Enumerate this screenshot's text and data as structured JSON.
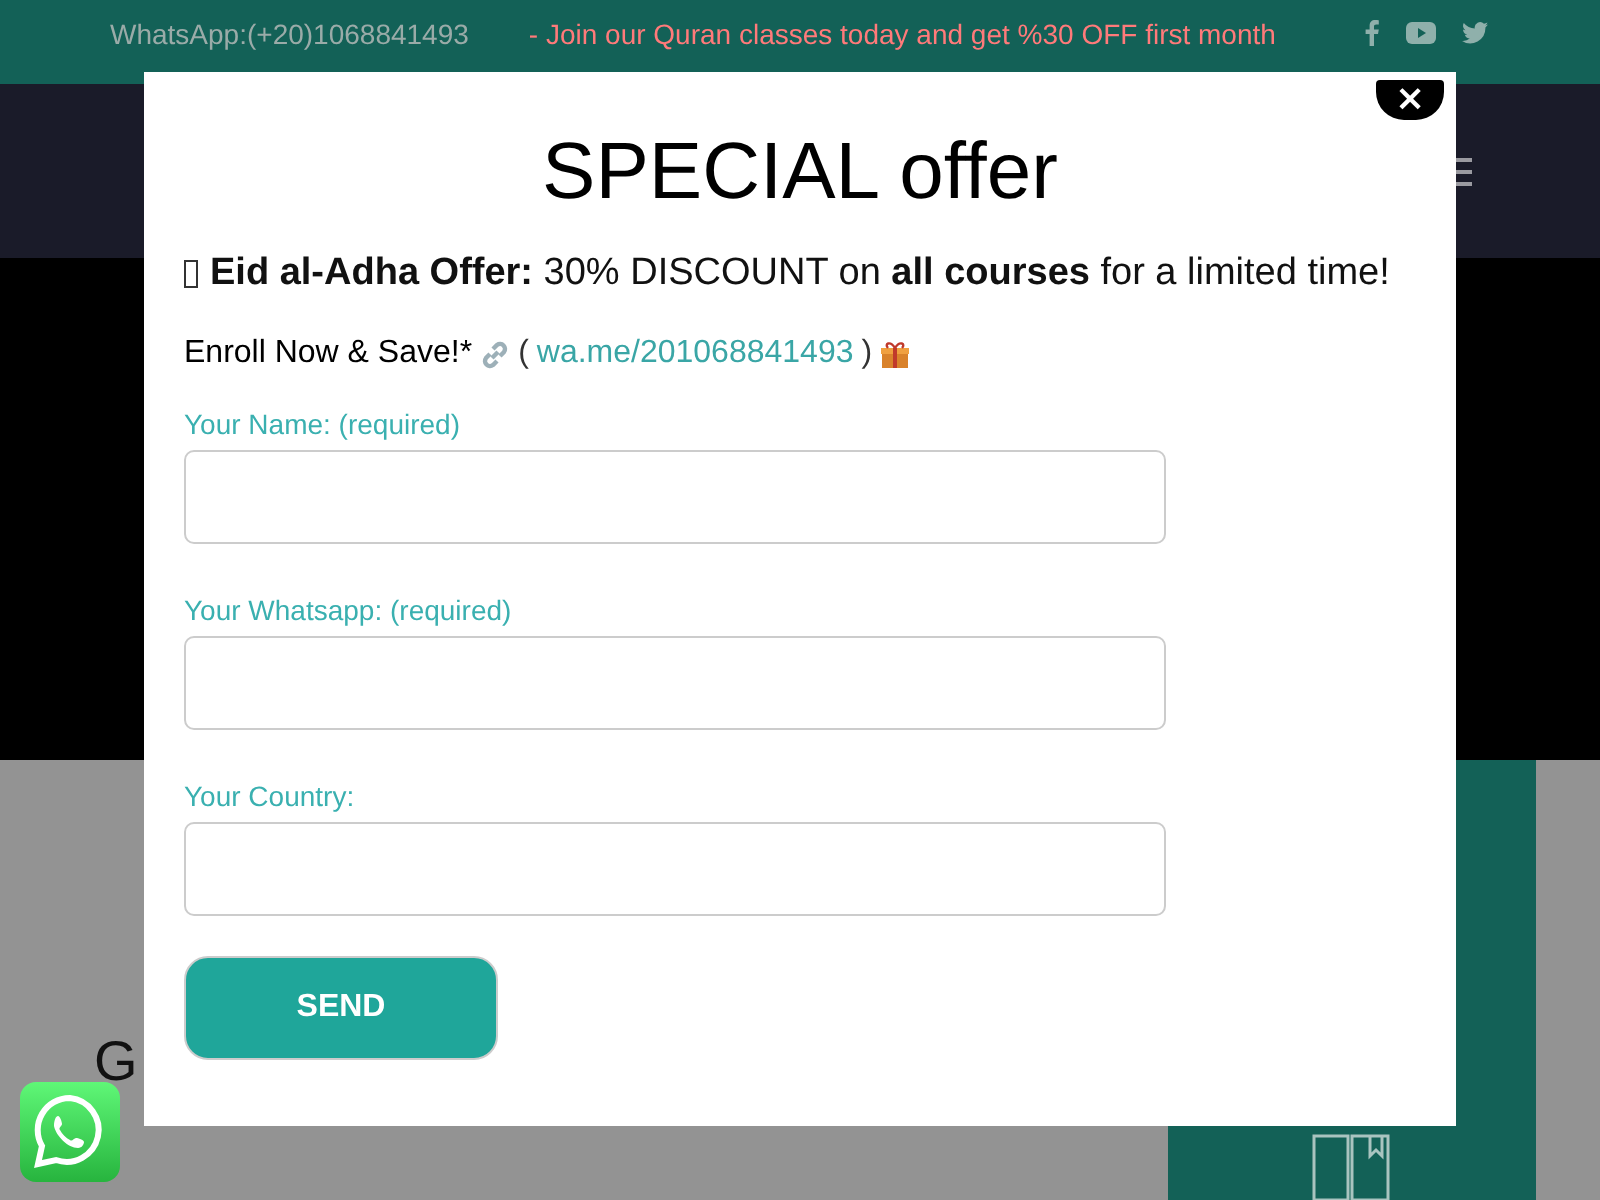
{
  "top_bar": {
    "phone": "WhatsApp:(+20)1068841493",
    "promo": "- Join our Quran classes today and get %30 OFF first month"
  },
  "section": {
    "heading": "G"
  },
  "popup": {
    "title": "SPECIAL offer",
    "offer": "**Eid al-Adha Offer:** 30% DISCOUNT on **all courses** for a limited time!",
    "enroll": "Enroll Now & Save!*",
    "link_open": "(",
    "link": "wa.me/201068841493",
    "link_close": ")",
    "fields": [
      {
        "label": "Your Name: (required)"
      },
      {
        "label": "Your Whatsapp: (required)"
      },
      {
        "label": "Your Country:"
      }
    ],
    "button": "SEND",
    "close": "×"
  }
}
